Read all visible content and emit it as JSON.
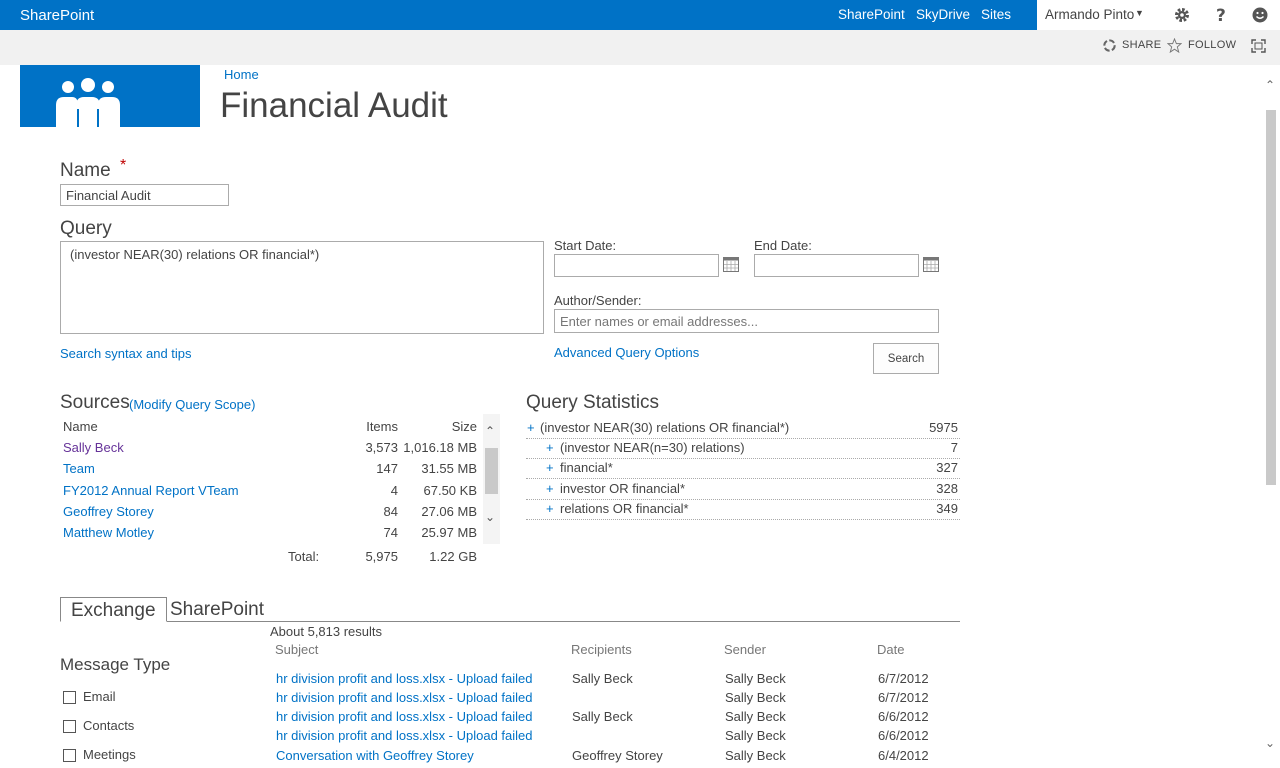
{
  "suitebar": {
    "brand": "SharePoint",
    "nav": [
      "SharePoint",
      "SkyDrive",
      "Sites"
    ],
    "user": "Armando Pinto"
  },
  "ribbon": {
    "share": "SHARE",
    "follow": "FOLLOW"
  },
  "breadcrumb": "Home",
  "page_title": "Financial Audit",
  "form": {
    "name_label": "Name",
    "required_mark": "*",
    "name_value": "Financial Audit",
    "query_label": "Query",
    "query_value": "(investor NEAR(30) relations OR financial*)",
    "start_date_label": "Start Date:",
    "end_date_label": "End Date:",
    "author_label": "Author/Sender:",
    "author_placeholder": "Enter names or email addresses...",
    "search_tips": "Search syntax and tips",
    "advanced_options": "Advanced Query Options",
    "search_button": "Search"
  },
  "sources": {
    "title": "Sources",
    "modify": "(Modify Query Scope)",
    "headers": {
      "name": "Name",
      "items": "Items",
      "size": "Size"
    },
    "rows": [
      {
        "name": "Sally Beck",
        "items": "3,573",
        "size": "1,016.18 MB"
      },
      {
        "name": "Team",
        "items": "147",
        "size": "31.55 MB"
      },
      {
        "name": "FY2012 Annual Report VTeam",
        "items": "4",
        "size": "67.50 KB"
      },
      {
        "name": "Geoffrey Storey",
        "items": "84",
        "size": "27.06 MB"
      },
      {
        "name": "Matthew Motley",
        "items": "74",
        "size": "25.97 MB"
      }
    ],
    "total_label": "Total:",
    "total_items": "5,975",
    "total_size": "1.22 GB"
  },
  "query_stats": {
    "title": "Query Statistics",
    "rows": [
      {
        "text": "(investor NEAR(30) relations OR financial*)",
        "count": "5975",
        "level": 0
      },
      {
        "text": "(investor NEAR(n=30) relations)",
        "count": "7",
        "level": 1
      },
      {
        "text": "financial*",
        "count": "327",
        "level": 1
      },
      {
        "text": "investor OR financial*",
        "count": "328",
        "level": 1
      },
      {
        "text": "relations OR financial*",
        "count": "349",
        "level": 1
      }
    ]
  },
  "tabs": [
    "Exchange",
    "SharePoint"
  ],
  "results": {
    "count_text": "About 5,813 results",
    "headers": {
      "subject": "Subject",
      "recipients": "Recipients",
      "sender": "Sender",
      "date": "Date"
    },
    "rows": [
      {
        "subject": "hr division profit and loss.xlsx - Upload failed",
        "recipients": "Sally Beck",
        "sender": "Sally Beck",
        "date": "6/7/2012"
      },
      {
        "subject": "hr division profit and loss.xlsx - Upload failed",
        "recipients": "",
        "sender": "Sally Beck",
        "date": "6/7/2012"
      },
      {
        "subject": "hr division profit and loss.xlsx - Upload failed",
        "recipients": "Sally Beck",
        "sender": "Sally Beck",
        "date": "6/6/2012"
      },
      {
        "subject": "hr division profit and loss.xlsx - Upload failed",
        "recipients": "",
        "sender": "Sally Beck",
        "date": "6/6/2012"
      },
      {
        "subject": "Conversation with Geoffrey Storey",
        "recipients": "Geoffrey Storey",
        "sender": "Sally Beck",
        "date": "6/4/2012"
      }
    ]
  },
  "message_type": {
    "title": "Message Type",
    "options": [
      "Email",
      "Contacts",
      "Meetings"
    ]
  },
  "colors": {
    "accent": "#0072c6",
    "ribbon": "#f1f1f1",
    "visited": "#663399",
    "required": "#bf0000"
  }
}
